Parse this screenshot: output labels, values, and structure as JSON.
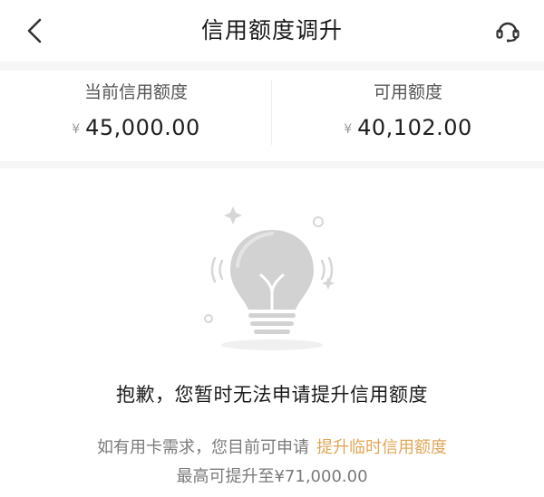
{
  "header": {
    "title": "信用额度调升",
    "back_icon": "chevron-left-icon",
    "support_icon": "headset-icon"
  },
  "summary": {
    "current_limit": {
      "label": "当前信用额度",
      "currency": "¥",
      "value": "45,000.00"
    },
    "available_limit": {
      "label": "可用额度",
      "currency": "¥",
      "value": "40,102.00"
    }
  },
  "illustration": {
    "icon": "lightbulb-icon"
  },
  "message": "抱歉，您暂时无法申请提升信用额度",
  "hint": {
    "text": "如有用卡需求，您目前可申请",
    "link_label": "提升临时信用额度",
    "max_text": "最高可提升至¥71,000.00"
  },
  "colors": {
    "link": "#e0a75a",
    "text_primary": "#1a1a1a",
    "text_secondary": "#7a7a7a",
    "divider": "#f6f6f6",
    "bulb": "#cfcfcf"
  }
}
